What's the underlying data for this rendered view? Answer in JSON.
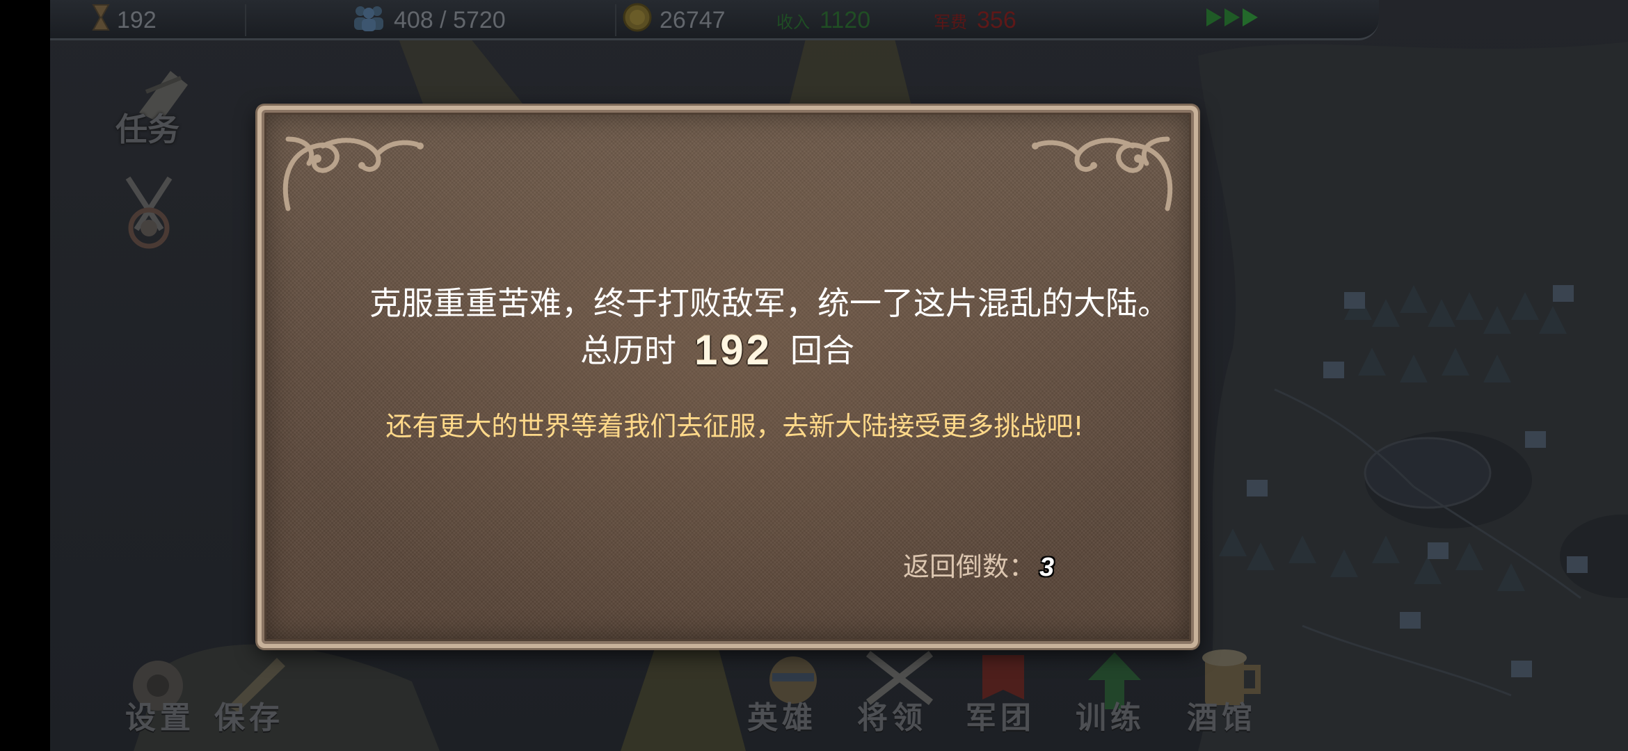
{
  "topbar": {
    "turn": "192",
    "population": "408 / 5720",
    "gold": "26747",
    "income_label": "收入",
    "income_value": "1120",
    "upkeep_label": "军费",
    "upkeep_value": "356",
    "speed_icon": "fast-forward-icon"
  },
  "side_menu": {
    "quest_label": "任务",
    "battle_icon": "crossed-swords-target-icon"
  },
  "bottom_menu": {
    "settings_label": "设置",
    "save_label": "保存",
    "hero_label": "英雄",
    "general_label": "将领",
    "legion_label": "军团",
    "train_label": "训练",
    "tavern_label": "酒馆"
  },
  "dialog": {
    "victory_message": "克服重重苦难，终于打败敌军，统一了这片混乱的大陆。",
    "turns_prefix": "总历时",
    "turns_value": "192",
    "turns_suffix": "回合",
    "encouragement": "还有更大的世界等着我们去征服，去新大陆接受更多挑战吧!",
    "countdown_label": "返回倒数：",
    "countdown_value": "3"
  },
  "colors": {
    "dialog_bg": "#634f41",
    "dialog_border": "#c8b29a",
    "encouragement_text": "#ffd98a",
    "income_green": "#2e7d32",
    "upkeep_red": "#8a1c1c"
  }
}
